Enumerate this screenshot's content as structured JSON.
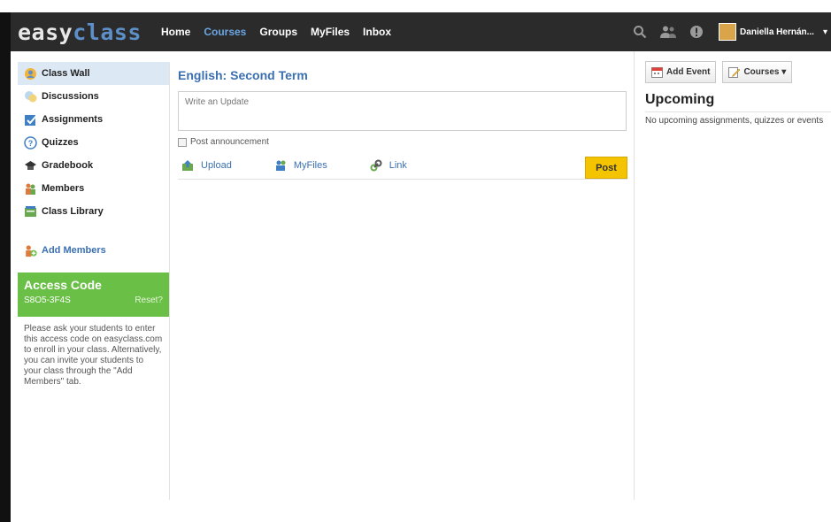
{
  "navbar": {
    "logo_part1": "easy",
    "logo_part2": "class",
    "links": [
      {
        "label": "Home",
        "active": false
      },
      {
        "label": "Courses",
        "active": true
      },
      {
        "label": "Groups",
        "active": false
      },
      {
        "label": "MyFiles",
        "active": false
      },
      {
        "label": "Inbox",
        "active": false
      }
    ],
    "icons": [
      "search-icon",
      "people-icon",
      "alert-icon"
    ],
    "user_name": "Daniella Hernán...",
    "caret": "▾"
  },
  "sidebar": {
    "items": [
      {
        "label": "Class Wall",
        "icon": "class-wall-icon",
        "active": true
      },
      {
        "label": "Discussions",
        "icon": "discussions-icon",
        "active": false
      },
      {
        "label": "Assignments",
        "icon": "assignments-icon",
        "active": false
      },
      {
        "label": "Quizzes",
        "icon": "quizzes-icon",
        "active": false
      },
      {
        "label": "Gradebook",
        "icon": "gradebook-icon",
        "active": false
      },
      {
        "label": "Members",
        "icon": "members-icon",
        "active": false
      },
      {
        "label": "Class Library",
        "icon": "library-icon",
        "active": false
      }
    ],
    "add_members": "Add Members",
    "access_code": {
      "title": "Access Code",
      "code": "S8O5-3F4S",
      "reset": "Reset?"
    },
    "help_text": "Please ask your students to enter this access code on easyclass.com to enroll in your class. Alternatively, you can invite your students to your class through the \"Add Members\" tab."
  },
  "main": {
    "course_title": "English: Second Term",
    "update_placeholder": "Write an Update",
    "announce_label": "Post announcement",
    "actions": [
      {
        "label": "Upload",
        "icon": "upload-icon"
      },
      {
        "label": "MyFiles",
        "icon": "myfiles-icon"
      },
      {
        "label": "Link",
        "icon": "link-icon"
      }
    ],
    "post_label": "Post"
  },
  "right": {
    "add_event": "Add Event",
    "courses": "Courses ▾",
    "upcoming_title": "Upcoming",
    "upcoming_text": "No upcoming assignments, quizzes or events"
  },
  "colors": {
    "navbar_bg": "#2b2b2b",
    "accent_blue": "#3a6fb0",
    "access_green": "#6abf46",
    "post_yellow": "#f5c400",
    "active_item_bg": "#dce9f5"
  }
}
